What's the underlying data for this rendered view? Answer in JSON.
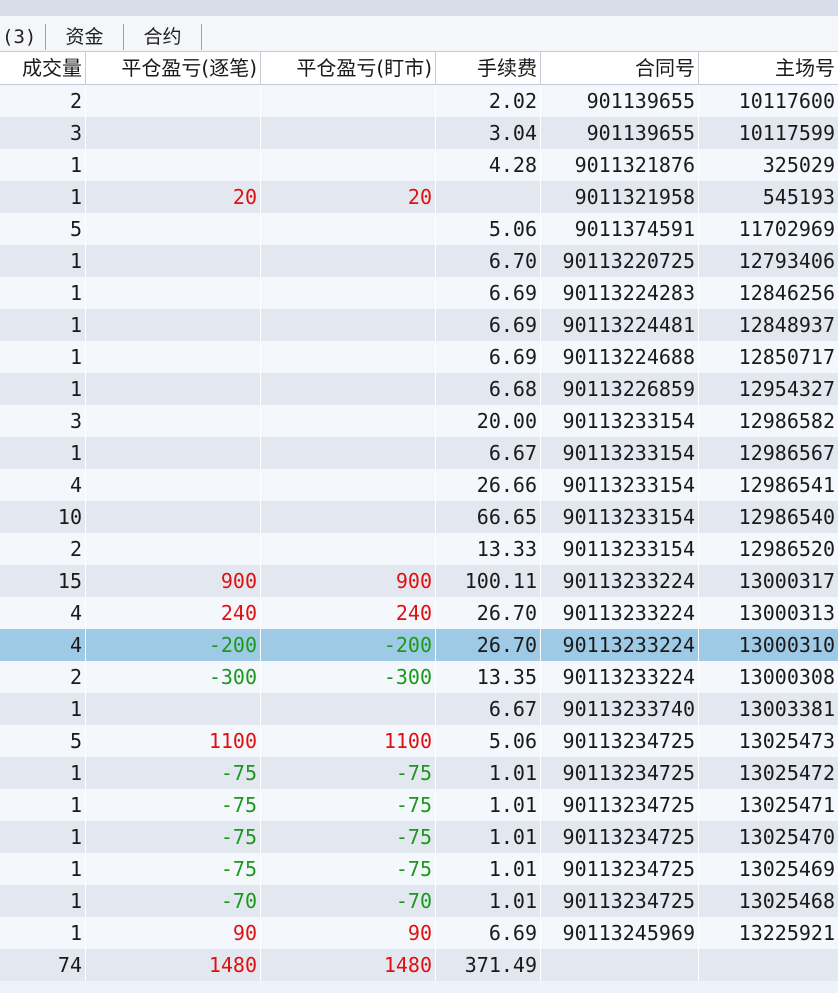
{
  "tabs": [
    "(3)",
    "资金",
    "合约"
  ],
  "columns": [
    "成交量",
    "平仓盈亏(逐笔)",
    "平仓盈亏(盯市)",
    "手续费",
    "合同号",
    "主场号"
  ],
  "rows": [
    {
      "volume": "2",
      "pnl_trade": "",
      "pnl_mtm": "",
      "fee": "2.02",
      "contract": "901139655",
      "order": "10117600"
    },
    {
      "volume": "3",
      "pnl_trade": "",
      "pnl_mtm": "",
      "fee": "3.04",
      "contract": "901139655",
      "order": "10117599"
    },
    {
      "volume": "1",
      "pnl_trade": "",
      "pnl_mtm": "",
      "fee": "4.28",
      "contract": "9011321876",
      "order": "325029"
    },
    {
      "volume": "1",
      "pnl_trade": "20",
      "pnl_mtm": "20",
      "fee": "",
      "contract": "9011321958",
      "order": "545193"
    },
    {
      "volume": "5",
      "pnl_trade": "",
      "pnl_mtm": "",
      "fee": "5.06",
      "contract": "9011374591",
      "order": "11702969"
    },
    {
      "volume": "1",
      "pnl_trade": "",
      "pnl_mtm": "",
      "fee": "6.70",
      "contract": "90113220725",
      "order": "12793406"
    },
    {
      "volume": "1",
      "pnl_trade": "",
      "pnl_mtm": "",
      "fee": "6.69",
      "contract": "90113224283",
      "order": "12846256"
    },
    {
      "volume": "1",
      "pnl_trade": "",
      "pnl_mtm": "",
      "fee": "6.69",
      "contract": "90113224481",
      "order": "12848937"
    },
    {
      "volume": "1",
      "pnl_trade": "",
      "pnl_mtm": "",
      "fee": "6.69",
      "contract": "90113224688",
      "order": "12850717"
    },
    {
      "volume": "1",
      "pnl_trade": "",
      "pnl_mtm": "",
      "fee": "6.68",
      "contract": "90113226859",
      "order": "12954327"
    },
    {
      "volume": "3",
      "pnl_trade": "",
      "pnl_mtm": "",
      "fee": "20.00",
      "contract": "90113233154",
      "order": "12986582"
    },
    {
      "volume": "1",
      "pnl_trade": "",
      "pnl_mtm": "",
      "fee": "6.67",
      "contract": "90113233154",
      "order": "12986567"
    },
    {
      "volume": "4",
      "pnl_trade": "",
      "pnl_mtm": "",
      "fee": "26.66",
      "contract": "90113233154",
      "order": "12986541"
    },
    {
      "volume": "10",
      "pnl_trade": "",
      "pnl_mtm": "",
      "fee": "66.65",
      "contract": "90113233154",
      "order": "12986540"
    },
    {
      "volume": "2",
      "pnl_trade": "",
      "pnl_mtm": "",
      "fee": "13.33",
      "contract": "90113233154",
      "order": "12986520"
    },
    {
      "volume": "15",
      "pnl_trade": "900",
      "pnl_mtm": "900",
      "fee": "100.11",
      "contract": "90113233224",
      "order": "13000317"
    },
    {
      "volume": "4",
      "pnl_trade": "240",
      "pnl_mtm": "240",
      "fee": "26.70",
      "contract": "90113233224",
      "order": "13000313"
    },
    {
      "volume": "4",
      "pnl_trade": "-200",
      "pnl_mtm": "-200",
      "fee": "26.70",
      "contract": "90113233224",
      "order": "13000310",
      "selected": true
    },
    {
      "volume": "2",
      "pnl_trade": "-300",
      "pnl_mtm": "-300",
      "fee": "13.35",
      "contract": "90113233224",
      "order": "13000308"
    },
    {
      "volume": "1",
      "pnl_trade": "",
      "pnl_mtm": "",
      "fee": "6.67",
      "contract": "90113233740",
      "order": "13003381"
    },
    {
      "volume": "5",
      "pnl_trade": "1100",
      "pnl_mtm": "1100",
      "fee": "5.06",
      "contract": "90113234725",
      "order": "13025473"
    },
    {
      "volume": "1",
      "pnl_trade": "-75",
      "pnl_mtm": "-75",
      "fee": "1.01",
      "contract": "90113234725",
      "order": "13025472"
    },
    {
      "volume": "1",
      "pnl_trade": "-75",
      "pnl_mtm": "-75",
      "fee": "1.01",
      "contract": "90113234725",
      "order": "13025471"
    },
    {
      "volume": "1",
      "pnl_trade": "-75",
      "pnl_mtm": "-75",
      "fee": "1.01",
      "contract": "90113234725",
      "order": "13025470"
    },
    {
      "volume": "1",
      "pnl_trade": "-75",
      "pnl_mtm": "-75",
      "fee": "1.01",
      "contract": "90113234725",
      "order": "13025469"
    },
    {
      "volume": "1",
      "pnl_trade": "-70",
      "pnl_mtm": "-70",
      "fee": "1.01",
      "contract": "90113234725",
      "order": "13025468"
    },
    {
      "volume": "1",
      "pnl_trade": "90",
      "pnl_mtm": "90",
      "fee": "6.69",
      "contract": "90113245969",
      "order": "13225921"
    }
  ],
  "total": {
    "volume": "74",
    "pnl_trade": "1480",
    "pnl_mtm": "1480",
    "fee": "371.49",
    "contract": "",
    "order": ""
  },
  "colors": {
    "profit": "#e01010",
    "loss": "#1a9a1a",
    "selected_row": "#9ecae6"
  }
}
